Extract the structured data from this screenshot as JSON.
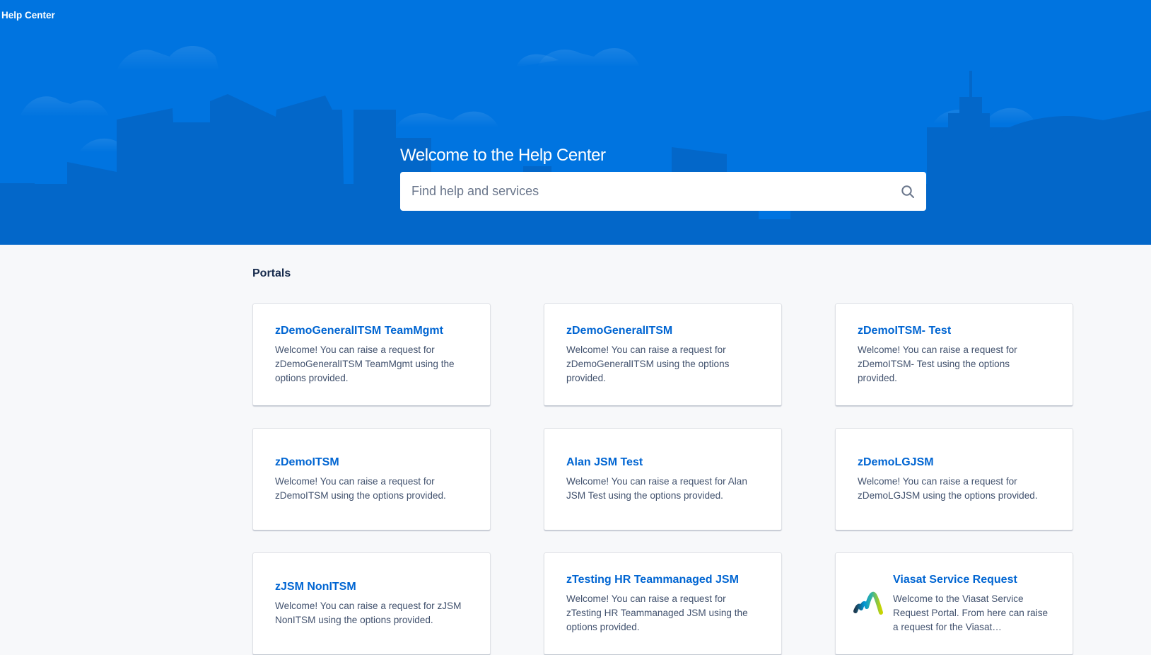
{
  "header": {
    "brand": "Help Center",
    "title": "Welcome to the Help Center",
    "search": {
      "placeholder": "Find help and services",
      "value": "",
      "icon": "search-icon"
    },
    "colors": {
      "hero_bg": "#0074e0",
      "skyline": "#0367c9"
    }
  },
  "portals": {
    "heading": "Portals",
    "items": [
      {
        "title": "zDemoGeneralITSM TeamMgmt",
        "description": "Welcome! You can raise a request for zDemoGeneralITSM TeamMgmt using the options provided."
      },
      {
        "title": "zDemoGeneralITSM",
        "description": "Welcome! You can raise a request for zDemoGeneralITSM using the options provided."
      },
      {
        "title": "zDemoITSM- Test",
        "description": "Welcome! You can raise a request for zDemoITSM- Test using the options provided."
      },
      {
        "title": "zDemoITSM",
        "description": "Welcome! You can raise a request for zDemoITSM using the options provided."
      },
      {
        "title": "Alan JSM Test",
        "description": "Welcome! You can raise a request for Alan JSM Test using the options provided."
      },
      {
        "title": "zDemoLGJSM",
        "description": "Welcome! You can raise a request for zDemoLGJSM using the options provided."
      },
      {
        "title": "zJSM NonITSM",
        "description": "Welcome! You can raise a request for zJSM NonITSM using the options provided."
      },
      {
        "title": "zTesting HR Teammanaged JSM",
        "description": "Welcome! You can raise a request for zTesting HR Teammanaged JSM using the options provided."
      },
      {
        "title": "Viasat Service Request",
        "description": "Welcome to the Viasat Service Request Portal. From here can raise a request for the Viasat…",
        "logo": "viasat-logo-icon"
      }
    ],
    "link_color": "#0065d2"
  }
}
